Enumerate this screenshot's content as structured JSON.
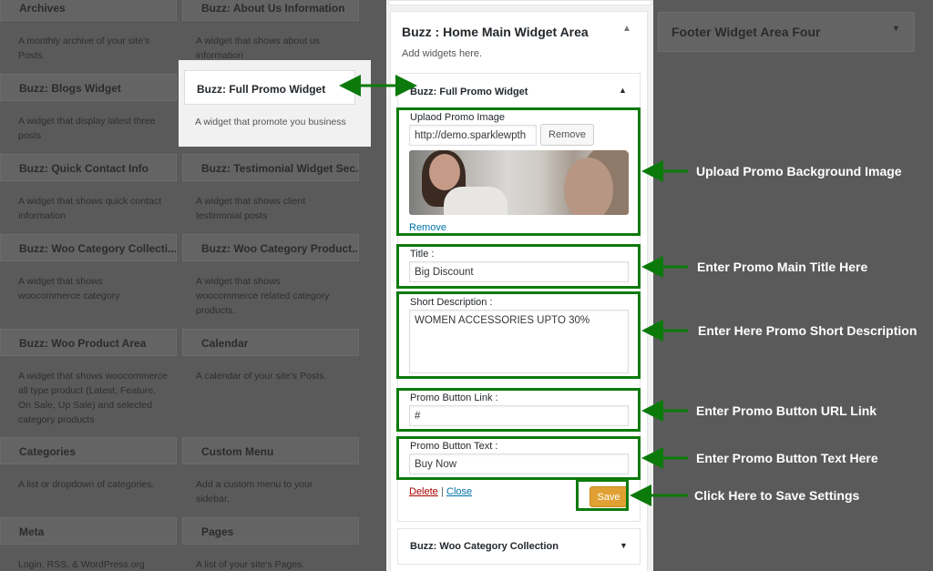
{
  "widget_list": {
    "cards": [
      {
        "title": "Archives",
        "desc": "A monthly archive of your site's Posts."
      },
      {
        "title": "Buzz: About Us Information",
        "desc": "A widget that shows about us information"
      },
      {
        "title": "Buzz: Blogs Widget",
        "desc": "A widget that display latest three posts"
      },
      {
        "title": "Buzz: Quick Contact Info",
        "desc": "A widget that shows quick contact information"
      },
      {
        "title": "Buzz: Testimonial Widget Sec...",
        "desc": "A widget that shows client testimonial posts"
      },
      {
        "title": "Buzz: Woo Category Collecti...",
        "desc": "A widget that shows woocommerce category"
      },
      {
        "title": "Buzz: Woo Category Product...",
        "desc": "A widget that shows woocommerce related category products."
      },
      {
        "title": "Buzz: Woo Product Area",
        "desc": "A widget that shows woocommerce all type product (Latest, Feature, On Sale, Up Sale) and selected category products"
      },
      {
        "title": "Calendar",
        "desc": "A calendar of your site's Posts."
      },
      {
        "title": "Categories",
        "desc": "A list or dropdown of categories."
      },
      {
        "title": "Custom Menu",
        "desc": "Add a custom menu to your sidebar."
      },
      {
        "title": "Meta",
        "desc": "Login, RSS, & WordPress.org links."
      },
      {
        "title": "Pages",
        "desc": "A list of your site's Pages."
      }
    ],
    "highlighted": {
      "title": "Buzz: Full Promo Widget",
      "desc": "A widget that promote you business"
    }
  },
  "sidebar": {
    "title": "Buzz : Home Main Widget Area",
    "desc": "Add widgets here.",
    "widget": {
      "title": "Buzz: Full Promo Widget",
      "upload_label": "Uplaod Promo Image",
      "image_url": "http://demo.sparklewpth",
      "remove_button": "Remove",
      "remove_link": "Remove",
      "title_label": "Title :",
      "title_value": "Big Discount",
      "desc_label": "Short Description :",
      "desc_value": "WOMEN ACCESSORIES UPTO 30%",
      "link_label": "Promo Button Link :",
      "link_value": "#",
      "btn_text_label": "Promo Button Text :",
      "btn_text_value": "Buy Now",
      "delete": "Delete",
      "separator": "|",
      "close": "Close",
      "save": "Save"
    },
    "next_widget": "Buzz: Woo Category Collection"
  },
  "footer_area": {
    "title": "Footer Widget Area Four"
  },
  "annotations": {
    "upload": "Upload Promo Background Image",
    "title": "Enter Promo Main Title Here",
    "desc": "Enter Here Promo Short Description",
    "link": "Enter Promo Button URL Link",
    "btn_text": "Enter Promo Button Text Here",
    "save": "Click Here to Save Settings"
  },
  "colors": {
    "annotation_green": "#0b7a0b",
    "save_button": "#e0a032",
    "link_blue": "#0073aa"
  },
  "icons": {
    "collapse": "triangle-up-icon",
    "expand": "triangle-down-icon",
    "arrow": "arrow-left-icon"
  }
}
